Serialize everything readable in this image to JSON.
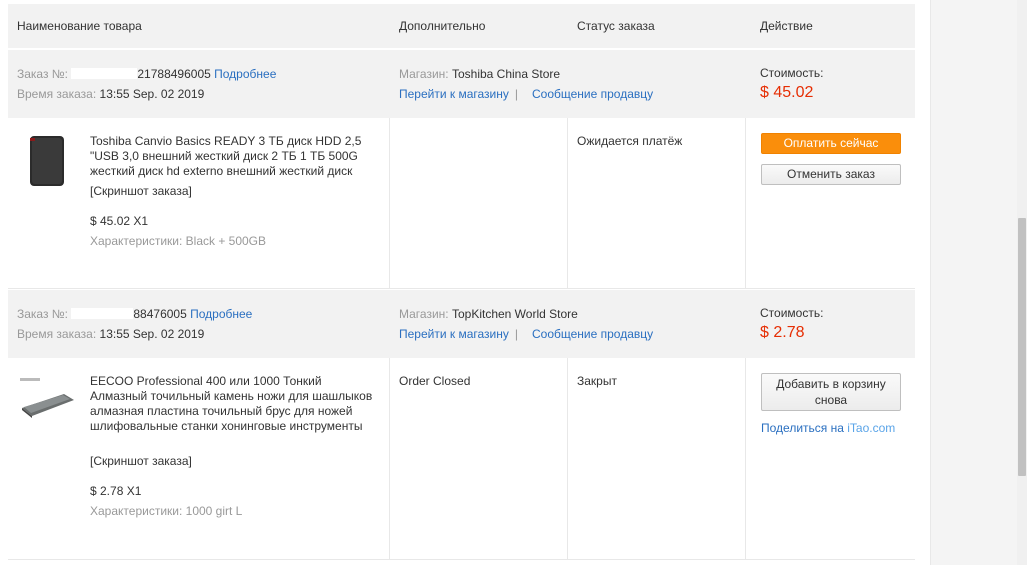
{
  "header": {
    "col_product": "Наименование товара",
    "col_extra": "Дополнительно",
    "col_status": "Статус заказа",
    "col_action": "Действие"
  },
  "orders": [
    {
      "order_label": "Заказ №:",
      "order_num_suffix": "21788496005",
      "details_link": "Подробнее",
      "time_label": "Время заказа:",
      "time_value": "13:55 Sep. 02 2019",
      "store_label": "Магазин:",
      "store_name": "Toshiba China Store",
      "goto_store": "Перейти к магазину",
      "message_seller": "Сообщение продавцу",
      "cost_label": "Стоимость:",
      "cost_value": "$ 45.02",
      "product_title": "Toshiba Canvio Basics READY 3 ТБ диск HDD 2,5 \"USB 3,0 внешний жесткий диск 2 ТБ 1 ТБ 500G жесткий диск hd externo внешний жесткий диск",
      "snapshot": "[Скриншот заказа]",
      "price_qty": "$ 45.02 X1",
      "specs": "Характеристики: Black + 500GB",
      "extra": "",
      "status": "Ожидается платёж",
      "btn_primary": "Оплатить сейчас",
      "btn_secondary": "Отменить заказ"
    },
    {
      "order_label": "Заказ №:",
      "order_num_suffix": "88476005",
      "details_link": "Подробнее",
      "time_label": "Время заказа:",
      "time_value": "13:55 Sep. 02 2019",
      "store_label": "Магазин:",
      "store_name": "TopKitchen World Store",
      "goto_store": "Перейти к магазину",
      "message_seller": "Сообщение продавцу",
      "cost_label": "Стоимость:",
      "cost_value": "$ 2.78",
      "product_title": "EECOO Professional 400 или 1000 Тонкий Алмазный точильный камень ножи для шашлыков алмазная пластина точильный брус для ножей шлифовальные станки хонинговые инструменты",
      "snapshot": "[Скриншот заказа]",
      "price_qty": "$ 2.78 X1",
      "specs": "Характеристики: 1000 girt L",
      "extra": "Order Closed",
      "status": "Закрыт",
      "btn_secondary": "Добавить в корзину снова",
      "share_prefix": "Поделиться на",
      "share_brand": "iTao.com"
    }
  ],
  "colors": {
    "price": "#e62e04",
    "link": "#2a6fc0",
    "pay_button": "#fa8e0b",
    "header_bg": "#f2f2f2"
  }
}
